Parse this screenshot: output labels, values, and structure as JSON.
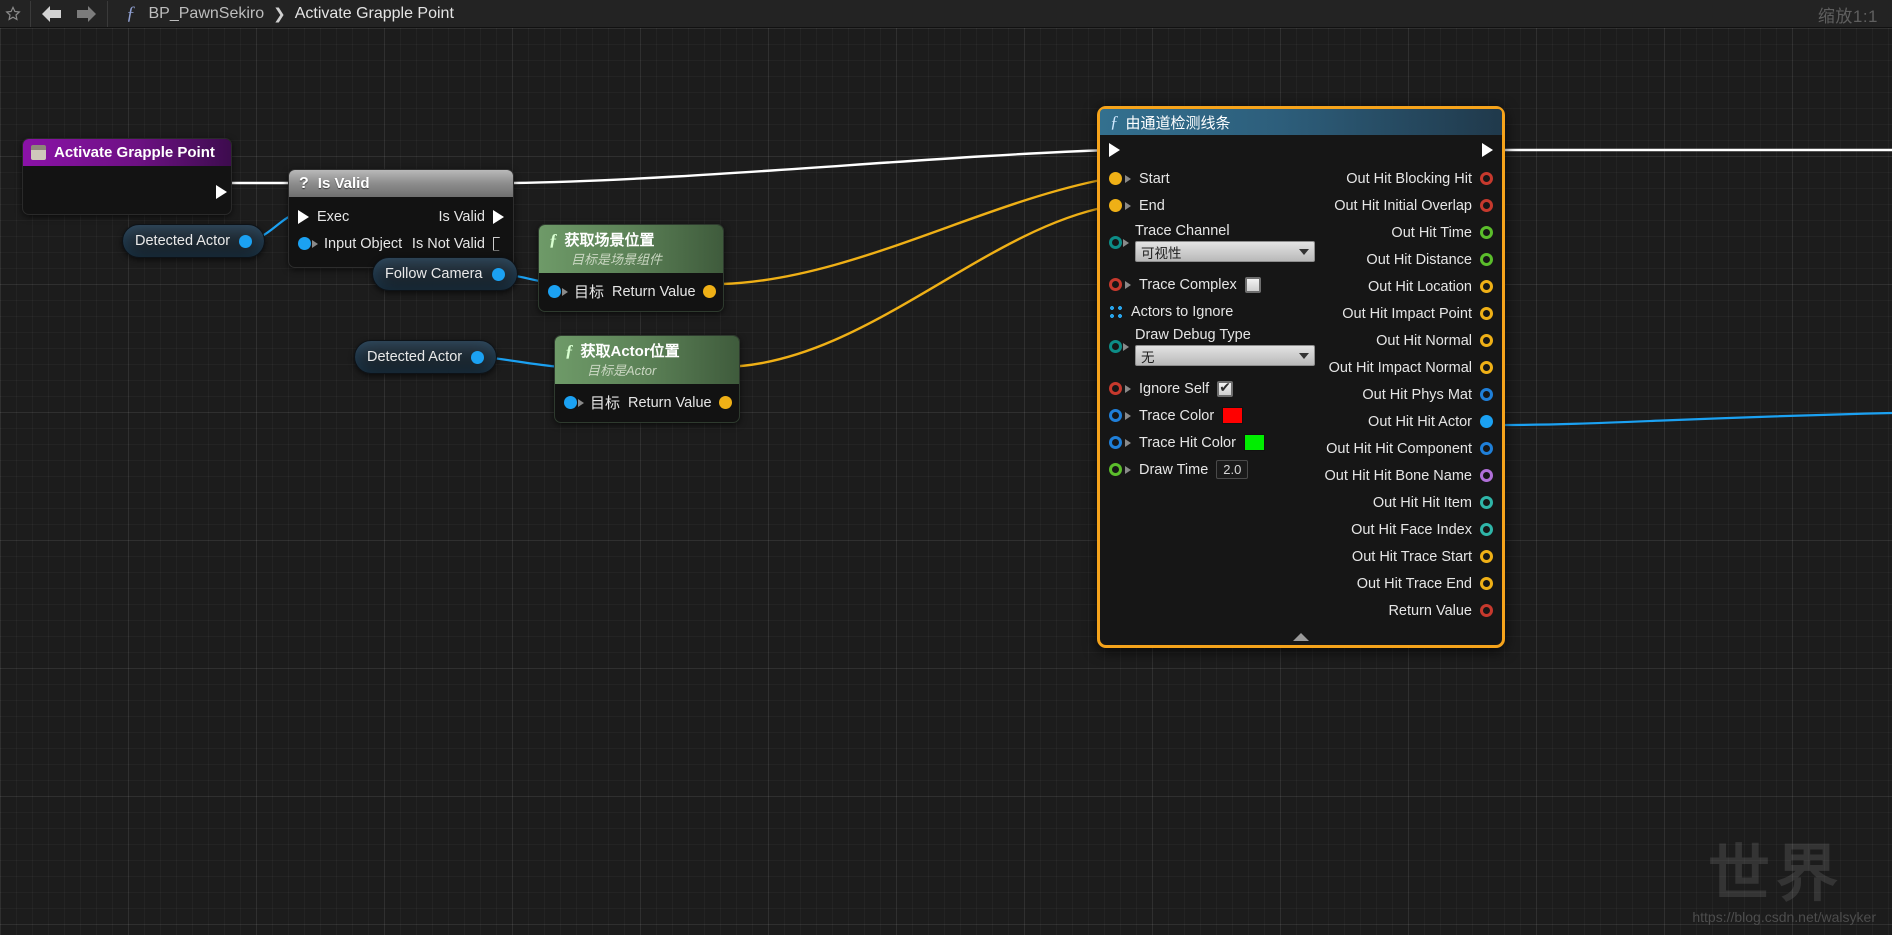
{
  "toolbar": {
    "back_icon": "arrow-left-icon",
    "forward_icon": "arrow-right-icon",
    "function_icon": "function-fx-icon",
    "breadcrumb": {
      "root": "BP_PawnSekiro",
      "separator": "❯",
      "current": "Activate Grapple Point"
    },
    "zoom_level": "缩放1:1"
  },
  "graph": {
    "nodes": {
      "event": {
        "title": "Activate Grapple Point",
        "icon": "event-node-icon",
        "out_exec": "exec-out-pin"
      },
      "is_valid": {
        "title": "Is Valid",
        "icon": "question-mark-icon",
        "inputs": [
          {
            "label": "Exec",
            "pin": "exec-in-pin"
          },
          {
            "label": "Input Object",
            "pin": "object-in-pin"
          }
        ],
        "outputs": [
          {
            "label": "Is Valid",
            "pin": "exec-out-pin"
          },
          {
            "label": "Is Not Valid",
            "pin": "exec-out-pin-hollow"
          }
        ]
      },
      "detected_actor_top": {
        "label": "Detected Actor",
        "pin": "object-out-pin"
      },
      "follow_camera": {
        "label": "Follow Camera",
        "pin": "object-out-pin"
      },
      "detected_actor_bottom": {
        "label": "Detected Actor",
        "pin": "object-out-pin"
      },
      "get_world_location": {
        "title": "获取场景位置",
        "subtitle": "目标是场景组件",
        "target_label": "目标",
        "return_label": "Return Value"
      },
      "get_actor_location": {
        "title": "获取Actor位置",
        "subtitle": "目标是Actor",
        "target_label": "目标",
        "return_label": "Return Value"
      },
      "line_trace": {
        "title": "由通道检测线条",
        "icon": "function-fx-icon",
        "selected": true,
        "inputs": [
          {
            "label": "Start",
            "pin": "vector-pin",
            "type": "vector"
          },
          {
            "label": "End",
            "pin": "vector-pin",
            "type": "vector"
          }
        ],
        "trace_channel": {
          "label": "Trace Channel",
          "value": "可视性"
        },
        "trace_complex": {
          "label": "Trace Complex",
          "checked": false
        },
        "actors_to_ignore": {
          "label": "Actors to Ignore"
        },
        "draw_debug_type": {
          "label": "Draw Debug Type",
          "value": "无"
        },
        "ignore_self": {
          "label": "Ignore Self",
          "checked": true
        },
        "trace_color": {
          "label": "Trace Color",
          "value": "#ff0000"
        },
        "trace_hit_color": {
          "label": "Trace Hit Color",
          "value": "#00ee00"
        },
        "draw_time": {
          "label": "Draw Time",
          "value": "2.0"
        },
        "outputs": [
          {
            "label": "Out Hit Blocking Hit",
            "pin": "ring-red"
          },
          {
            "label": "Out Hit Initial Overlap",
            "pin": "ring-red"
          },
          {
            "label": "Out Hit Time",
            "pin": "ring-green"
          },
          {
            "label": "Out Hit Distance",
            "pin": "ring-green"
          },
          {
            "label": "Out Hit Location",
            "pin": "ring-yellow"
          },
          {
            "label": "Out Hit Impact Point",
            "pin": "ring-yellow"
          },
          {
            "label": "Out Hit Normal",
            "pin": "ring-yellow"
          },
          {
            "label": "Out Hit Impact Normal",
            "pin": "ring-yellow"
          },
          {
            "label": "Out Hit Phys Mat",
            "pin": "ring-blue"
          },
          {
            "label": "Out Hit Hit Actor",
            "pin": "dot-blue"
          },
          {
            "label": "Out Hit Hit Component",
            "pin": "ring-blue"
          },
          {
            "label": "Out Hit Hit Bone Name",
            "pin": "ring-purple"
          },
          {
            "label": "Out Hit Hit Item",
            "pin": "ring-teal"
          },
          {
            "label": "Out Hit Face Index",
            "pin": "ring-teal"
          },
          {
            "label": "Out Hit Trace Start",
            "pin": "ring-yellow"
          },
          {
            "label": "Out Hit Trace End",
            "pin": "ring-yellow"
          },
          {
            "label": "Return Value",
            "pin": "ring-red"
          }
        ],
        "collapse_icon": "collapse-arrow-icon"
      }
    }
  },
  "watermark": {
    "url": "https://blog.csdn.net/walsyker",
    "mark": "世界"
  },
  "colors": {
    "selection": "#f5a31b",
    "exec_wire": "#ffffff",
    "data_wire_vector": "#efb016",
    "data_wire_object": "#1ba1f2"
  }
}
